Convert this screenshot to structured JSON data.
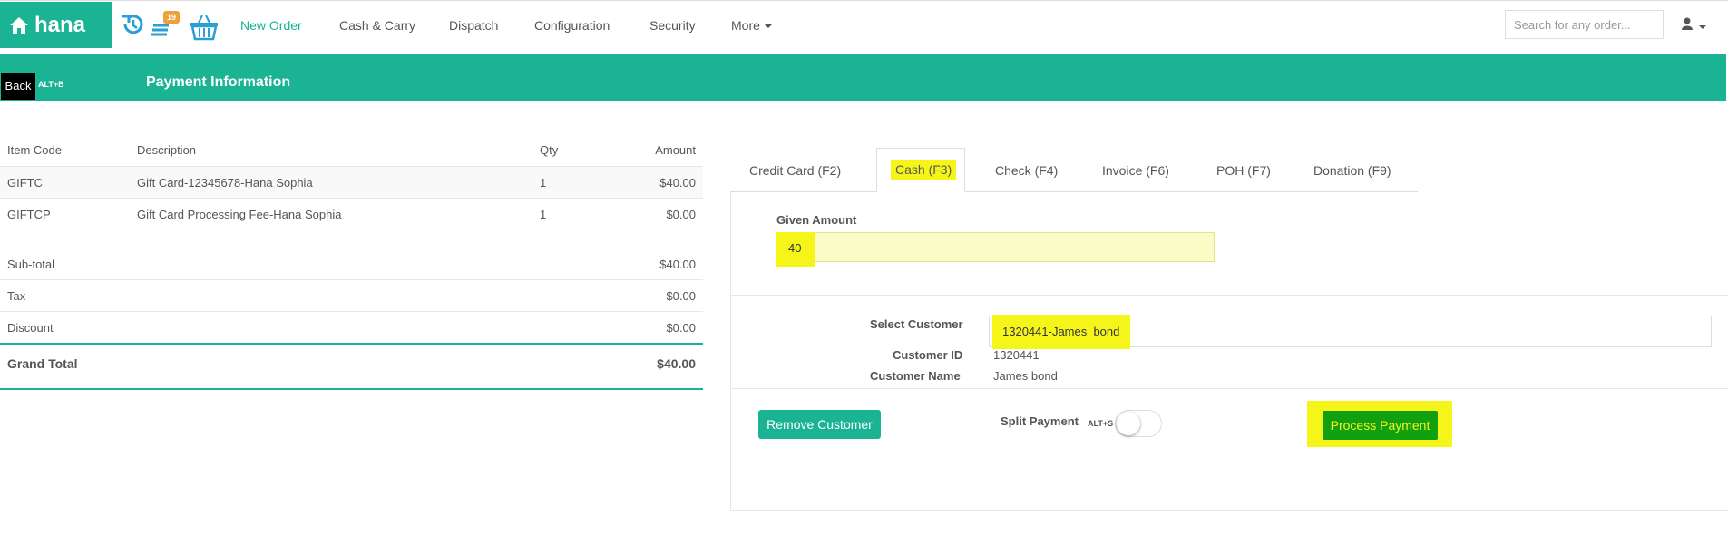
{
  "brand": {
    "name": "hana"
  },
  "header": {
    "badge_count": "19",
    "nav": [
      {
        "label": "New Order"
      },
      {
        "label": "Cash & Carry"
      },
      {
        "label": "Dispatch"
      },
      {
        "label": "Configuration"
      },
      {
        "label": "Security"
      },
      {
        "label": "More"
      }
    ],
    "search_placeholder": "Search for any order..."
  },
  "subheader": {
    "back_label": "Back",
    "back_shortcut": "ALT+B",
    "title": "Payment Information"
  },
  "items": {
    "columns": {
      "code": "Item Code",
      "description": "Description",
      "qty": "Qty",
      "amount": "Amount"
    },
    "rows": [
      {
        "code": "GIFTC",
        "description": "Gift Card-12345678-Hana Sophia",
        "qty": "1",
        "amount": "$40.00"
      },
      {
        "code": "GIFTCP",
        "description": "Gift Card Processing Fee-Hana Sophia",
        "qty": "1",
        "amount": "$0.00"
      }
    ],
    "totals": [
      {
        "label": "Sub-total",
        "value": "$40.00"
      },
      {
        "label": "Tax",
        "value": "$0.00"
      },
      {
        "label": "Discount",
        "value": "$0.00"
      }
    ],
    "grand_total": {
      "label": "Grand Total",
      "value": "$40.00"
    }
  },
  "payment": {
    "tabs": [
      {
        "label": "Credit Card (F2)"
      },
      {
        "label": "Cash (F3)"
      },
      {
        "label": "Check (F4)"
      },
      {
        "label": "Invoice (F6)"
      },
      {
        "label": "POH (F7)"
      },
      {
        "label": "Donation (F9)"
      }
    ],
    "active_tab": "Cash (F3)",
    "given_amount_label": "Given Amount",
    "given_amount_value": "40",
    "select_customer_label": "Select Customer",
    "select_customer_value": "1320441-James  bond",
    "customer_id_label": "Customer ID",
    "customer_id_value": "1320441",
    "customer_name_label": "Customer Name",
    "customer_name_value": "James bond",
    "remove_customer_label": "Remove Customer",
    "split_payment_label": "Split Payment",
    "split_payment_shortcut": "ALT+S",
    "split_payment_on": false,
    "process_payment_label": "Process Payment"
  },
  "colors": {
    "brand": "#1ab394",
    "highlight": "#f5f51a",
    "process_button": "#10a010",
    "back_button": "#000000"
  },
  "icons": [
    "home-icon",
    "history-icon",
    "orders-icon",
    "basket-icon",
    "user-icon",
    "caret-down-icon"
  ]
}
